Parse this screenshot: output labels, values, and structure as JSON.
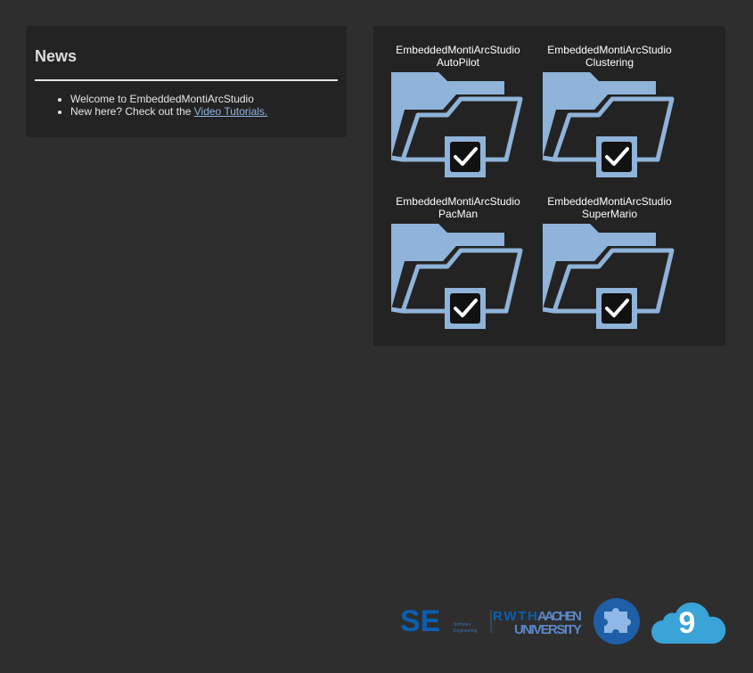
{
  "news": {
    "title": "News",
    "items": [
      {
        "text": "Welcome to EmbeddedMontiArcStudio"
      },
      {
        "text_prefix": "New here? Check out the ",
        "link_text": "Video Tutorials."
      }
    ]
  },
  "projects": [
    {
      "line1": "EmbeddedMontiArcStudio",
      "line2": "AutoPilot",
      "checked": true
    },
    {
      "line1": "EmbeddedMontiArcStudio",
      "line2": "Clustering",
      "checked": true
    },
    {
      "line1": "EmbeddedMontiArcStudio",
      "line2": "PacMan",
      "checked": true
    },
    {
      "line1": "EmbeddedMontiArcStudio",
      "line2": "SuperMario",
      "checked": true
    }
  ],
  "footer": {
    "logos": [
      {
        "icon": "se-logo",
        "text_main": "SE",
        "text_sub1": "Software",
        "text_sub2": "Engineering"
      },
      {
        "icon": "rwth-logo",
        "text_line1_a": "RWTH",
        "text_line1_b": "AACHEN",
        "text_line2": "UNIVERSITY"
      },
      {
        "icon": "puzzle-logo"
      },
      {
        "icon": "cloud9-logo",
        "text": "9"
      }
    ]
  },
  "colors": {
    "background": "#2e2e2e",
    "panel": "#232323",
    "folder": "#8fb3d9",
    "link": "#8fb6e0",
    "text": "#e6e6e6"
  }
}
